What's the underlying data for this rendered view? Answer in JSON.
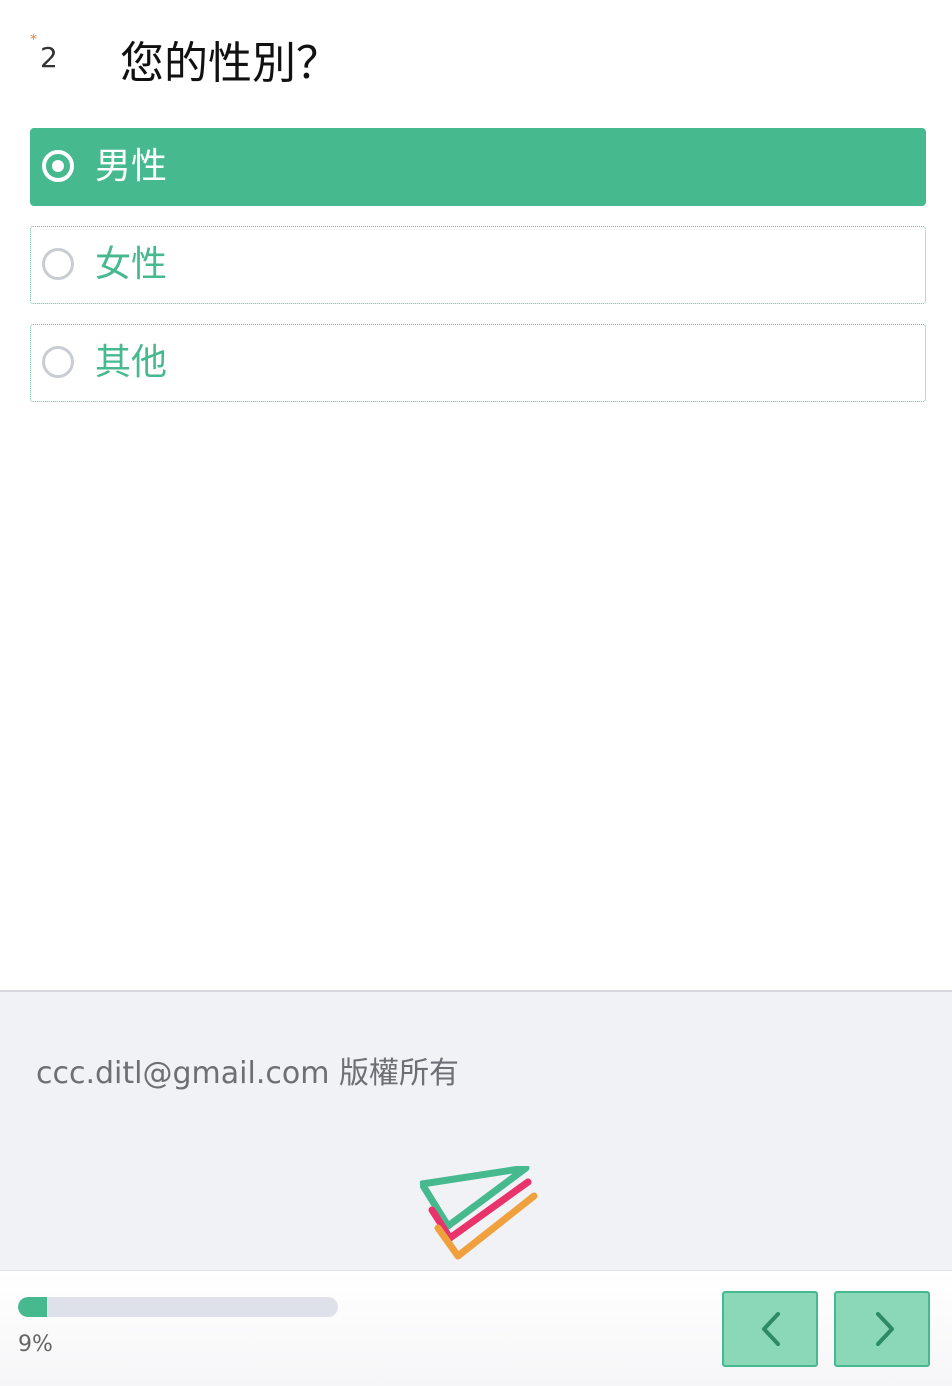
{
  "question": {
    "required_mark": "*",
    "number": "2",
    "title": "您的性別？",
    "options": [
      {
        "label": "男性",
        "selected": true
      },
      {
        "label": "女性",
        "selected": false
      },
      {
        "label": "其他",
        "selected": false
      }
    ]
  },
  "footer": {
    "copyright": "ccc.ditl@gmail.com 版權所有",
    "logo_icon": "survey-check-logo-icon"
  },
  "bottom_bar": {
    "progress_value": 0.09,
    "progress_text": "9%",
    "prev_icon": "chevron-left-icon",
    "next_icon": "chevron-right-icon"
  },
  "colors": {
    "accent": "#46b98f",
    "nav_button": "#8ad8b8",
    "required": "#e8833a",
    "logo_green": "#46b98f",
    "logo_pink": "#e8336b",
    "logo_orange": "#f0a03c"
  }
}
